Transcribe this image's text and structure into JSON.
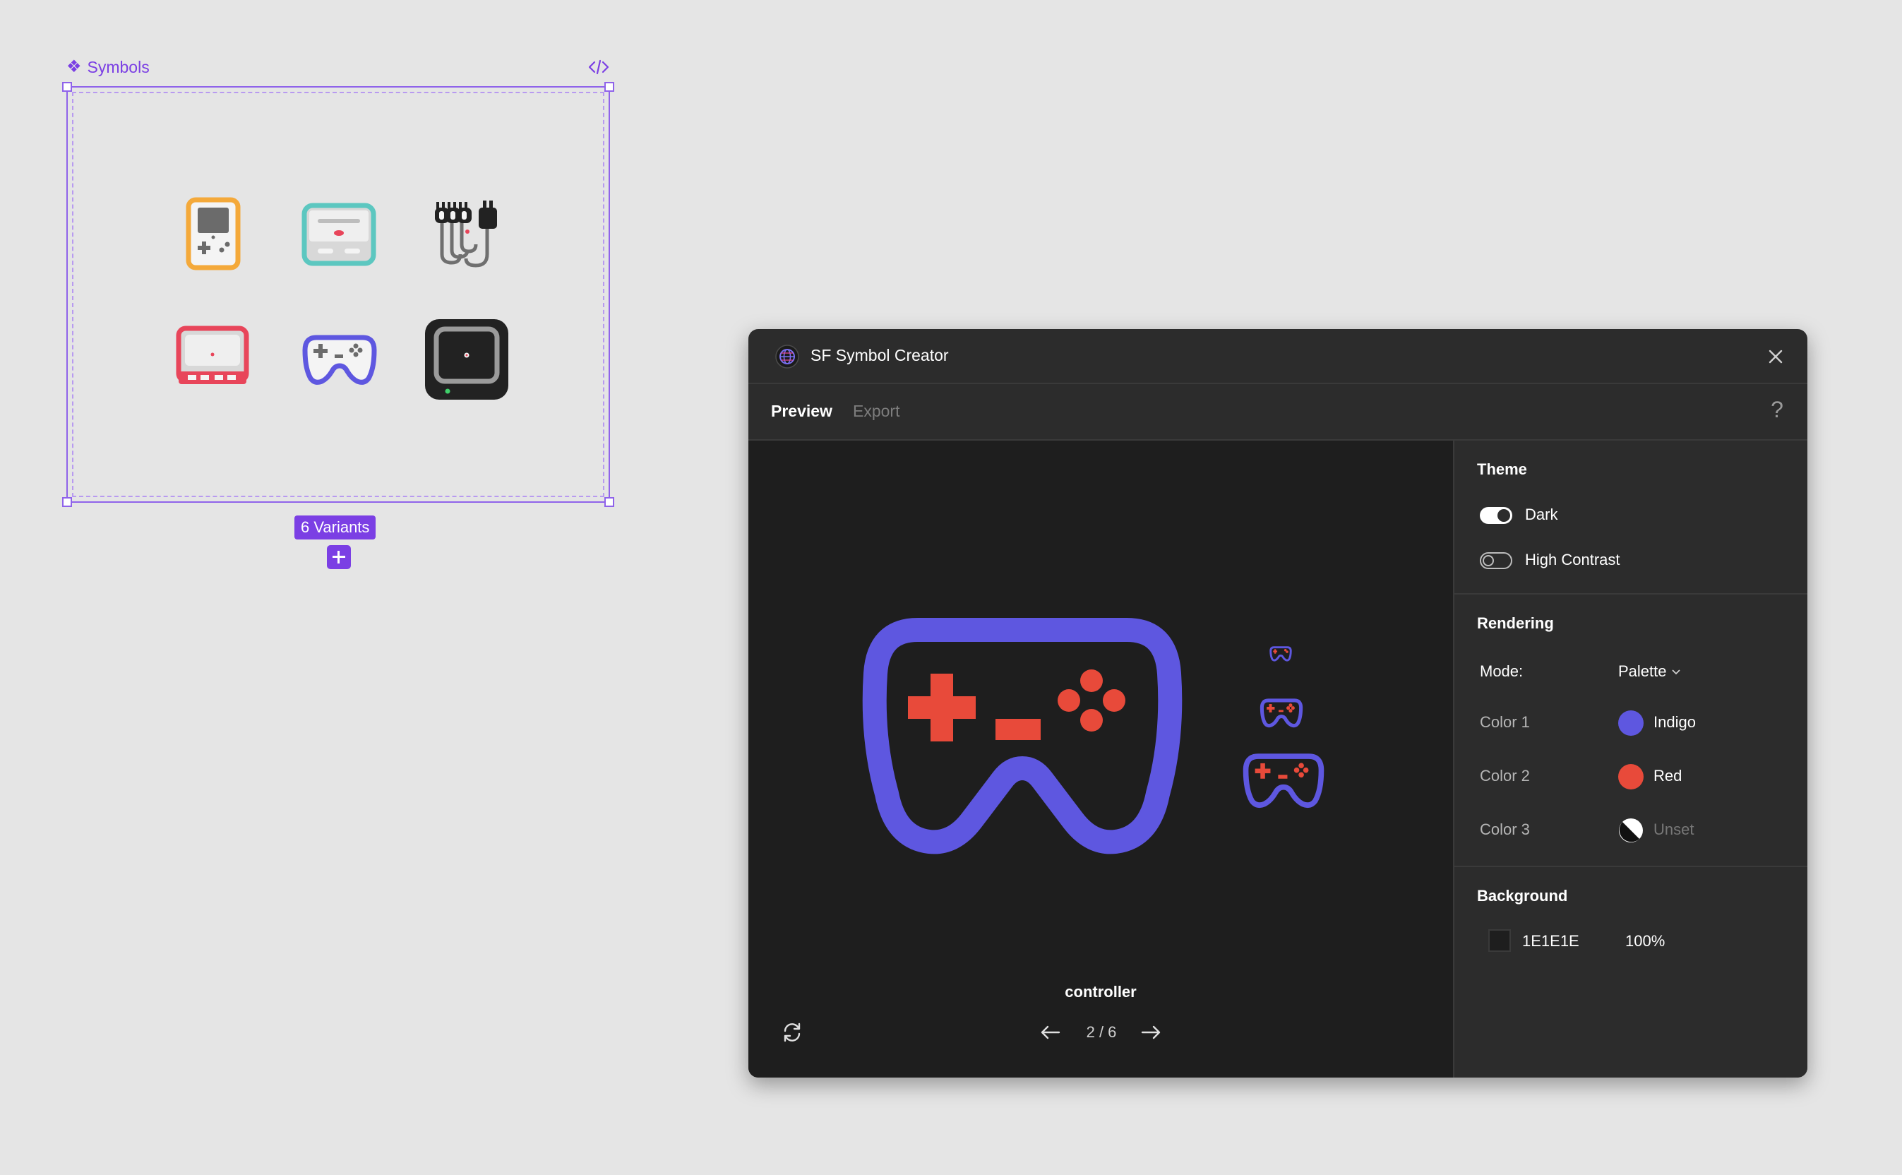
{
  "canvas": {
    "frame_label": "Symbols",
    "code_icon": "code-icon",
    "variants_badge": "6 Variants",
    "add_variant_icon": "plus-icon",
    "variants": [
      {
        "name": "handheld-console",
        "color": "#f4a93a"
      },
      {
        "name": "retro-console",
        "color": "#5cc7c0"
      },
      {
        "name": "av-cables",
        "color": "#222222"
      },
      {
        "name": "famicom-console",
        "color": "#e8455a"
      },
      {
        "name": "controller",
        "color": "#5e57e0"
      },
      {
        "name": "cube-console",
        "color": "#222222"
      }
    ]
  },
  "plugin": {
    "title": "SF Symbol Creator",
    "logo_icon": "globe-logo-icon",
    "close_icon": "close-icon",
    "tabs": [
      {
        "label": "Preview",
        "active": true
      },
      {
        "label": "Export",
        "active": false
      }
    ],
    "help_label": "?",
    "preview": {
      "symbol_name": "controller",
      "page_indicator": "2 / 6",
      "refresh_icon": "refresh-icon",
      "prev_icon": "arrow-left-icon",
      "next_icon": "arrow-right-icon",
      "primary_color": "#5e57e0",
      "secondary_color": "#e84a3a",
      "background": "#1e1e1e"
    },
    "theme": {
      "title": "Theme",
      "toggles": [
        {
          "label": "Dark",
          "on": true
        },
        {
          "label": "High Contrast",
          "on": false
        }
      ]
    },
    "rendering": {
      "title": "Rendering",
      "mode_label": "Mode:",
      "mode_value": "Palette",
      "colors": [
        {
          "label": "Color 1",
          "name": "Indigo",
          "hex": "#5e57e0"
        },
        {
          "label": "Color 2",
          "name": "Red",
          "hex": "#e84a3a"
        },
        {
          "label": "Color 3",
          "name": "Unset",
          "hex": ""
        }
      ]
    },
    "background": {
      "title": "Background",
      "hex": "1E1E1E",
      "opacity": "100%"
    }
  }
}
